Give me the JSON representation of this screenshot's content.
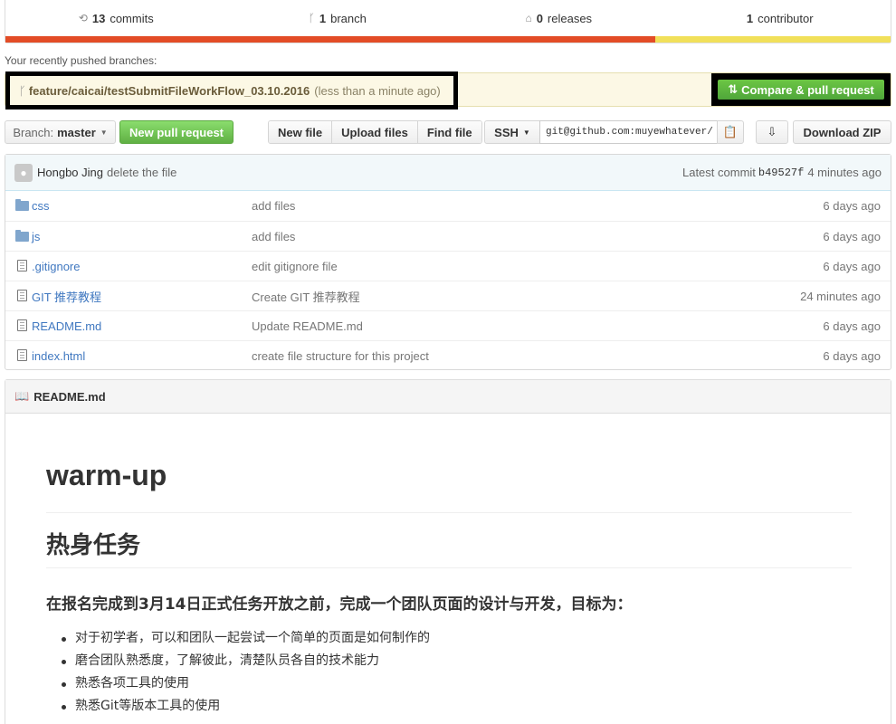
{
  "summary": {
    "commits_count": "13",
    "commits_label": "commits",
    "branch_count": "1",
    "branch_label": "branch",
    "releases_count": "0",
    "releases_label": "releases",
    "contributor_count": "1",
    "contributor_label": "contributor",
    "languages": [
      {
        "color": "#e34c26",
        "percent": 73.4
      },
      {
        "color": "#f1e05a",
        "percent": 26.6
      }
    ]
  },
  "recent": {
    "label": "Your recently pushed branches:",
    "branch_name": "feature/caicai/testSubmitFileWorkFlow_03.10.2016",
    "time": "(less than a minute ago)",
    "compare_button": "Compare & pull request"
  },
  "toolbar": {
    "branch_label": "Branch:",
    "branch_value": "master",
    "new_pr": "New pull request",
    "new_file": "New file",
    "upload_files": "Upload files",
    "find_file": "Find file",
    "ssh": "SSH",
    "clone_url": "git@github.com:muyewhatever/",
    "download_zip": "Download ZIP"
  },
  "commit": {
    "author": "Hongbo Jing",
    "message": "delete the file",
    "latest_label": "Latest commit",
    "sha": "b49527f",
    "time": "4 minutes ago"
  },
  "files": [
    {
      "type": "dir",
      "name": "css",
      "message": "add files",
      "age": "6 days ago"
    },
    {
      "type": "dir",
      "name": "js",
      "message": "add files",
      "age": "6 days ago"
    },
    {
      "type": "file",
      "name": ".gitignore",
      "message": "edit gitignore file",
      "age": "6 days ago"
    },
    {
      "type": "file",
      "name": "GIT 推荐教程",
      "message": "Create GIT 推荐教程",
      "age": "24 minutes ago"
    },
    {
      "type": "file",
      "name": "README.md",
      "message": "Update README.md",
      "age": "6 days ago"
    },
    {
      "type": "file",
      "name": "index.html",
      "message": "create file structure for this project",
      "age": "6 days ago"
    }
  ],
  "readme": {
    "header": "README.md",
    "h1": "warm-up",
    "h2": "热身任务",
    "h3": "在报名完成到3月14日正式任务开放之前，完成一个团队页面的设计与开发，目标为：",
    "items": [
      "对于初学者，可以和团队一起尝试一个简单的页面是如何制作的",
      "磨合团队熟悉度，了解彼此，清楚队员各自的技术能力",
      "熟悉各项工具的使用",
      "熟悉Git等版本工具的使用"
    ]
  }
}
